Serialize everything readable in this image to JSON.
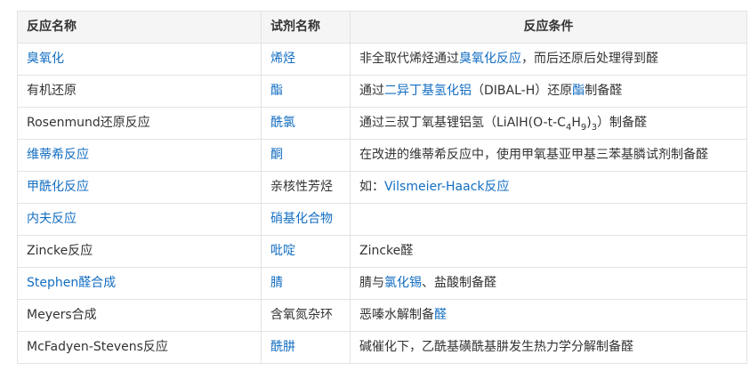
{
  "colors": {
    "link": "#136ec2",
    "text": "#333333",
    "header_bg": "#f5f5f5",
    "border": "#e3e3e3"
  },
  "header": {
    "col1": "反应名称",
    "col2": "试剂名称",
    "col3": "反应条件"
  },
  "rows": [
    {
      "name": "臭氧化",
      "reagent": "烯烃",
      "cond_a": "非全取代烯烃通过",
      "cond_link": "臭氧化反应",
      "cond_b": "，而后还原后处理得到醛"
    },
    {
      "name": "有机还原",
      "reagent": "酯",
      "cond_a": "通过",
      "cond_link": "二异丁基氢化铝",
      "cond_b": "（DIBAL-H）还原",
      "cond_link2": "酯",
      "cond_c": "制备醛"
    },
    {
      "name": "Rosenmund还原反应",
      "reagent": "酰氯",
      "cond_a": "通过三叔丁氧基锂铝氢（LiAlH(O-t-C",
      "sub1": "4",
      "cond_b": "H",
      "sub2": "9",
      "cond_c": ")",
      "sub3": "3",
      "cond_d": "）制备醛"
    },
    {
      "name": "维蒂希反应",
      "reagent": "酮",
      "cond_a": "在改进的维蒂希反应中，使用甲氧基亚甲基三苯基膦试剂制备醛"
    },
    {
      "name": "甲酰化反应",
      "reagent": "亲核性芳烃",
      "cond_a": "如：",
      "cond_link": "Vilsmeier-Haack反应"
    },
    {
      "name": "内夫反应",
      "reagent": "硝基化合物",
      "cond_a": ""
    },
    {
      "name": "Zincke反应",
      "reagent": "吡啶",
      "cond_a": "Zincke醛"
    },
    {
      "name": "Stephen醛合成",
      "reagent": "腈",
      "cond_a": "腈与",
      "cond_link": "氯化锡",
      "cond_b": "、盐酸制备醛"
    },
    {
      "name": "Meyers合成",
      "reagent": "含氧氮杂环",
      "cond_a": "恶嗪水解制备",
      "cond_link": "醛"
    },
    {
      "name": "McFadyen-Stevens反应",
      "reagent": "酰肼",
      "cond_a": "碱催化下，乙酰基磺酰基肼发生热力学分解制备醛"
    }
  ]
}
